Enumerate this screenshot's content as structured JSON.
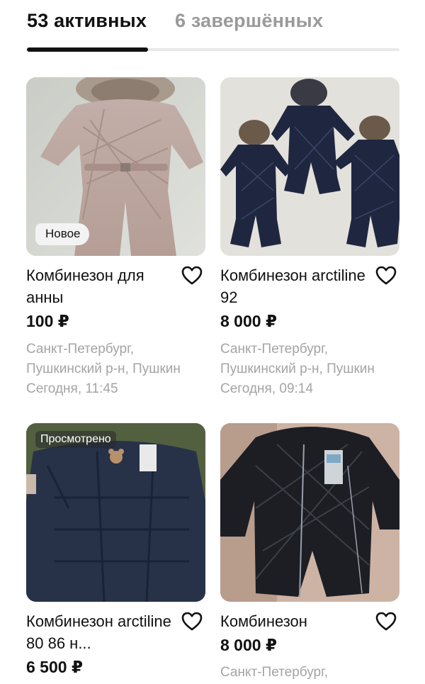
{
  "tabs": {
    "active_label": "53 активных",
    "inactive_label": "6 завершённых"
  },
  "listings": [
    {
      "title": "Комбинезон для анны",
      "price": "100 ₽",
      "location_line1": "Санкт-Петербург,",
      "location_line2": "Пушкинский р-н, Пушкин",
      "date": "Сегодня, 11:45",
      "badge": "Новое",
      "favorite_icon": "heart-outline-icon"
    },
    {
      "title": "Комбинезон arctiline 92",
      "price": "8 000 ₽",
      "location_line1": "Санкт-Петербург,",
      "location_line2": "Пушкинский р-н, Пушкин",
      "date": "Сегодня, 09:14",
      "favorite_icon": "heart-outline-icon"
    },
    {
      "title": "Комбинезон arctiline 80 86 н...",
      "price": "6 500 ₽",
      "badge": "Просмотрено",
      "favorite_icon": "heart-outline-icon"
    },
    {
      "title": "Комбинезон",
      "price": "8 000 ₽",
      "location_line1": "Санкт-Петербург,",
      "favorite_icon": "heart-outline-icon"
    }
  ],
  "colors": {
    "text": "#111111",
    "muted": "#a4a4a4",
    "inactive_tab": "#9a9a9a"
  }
}
